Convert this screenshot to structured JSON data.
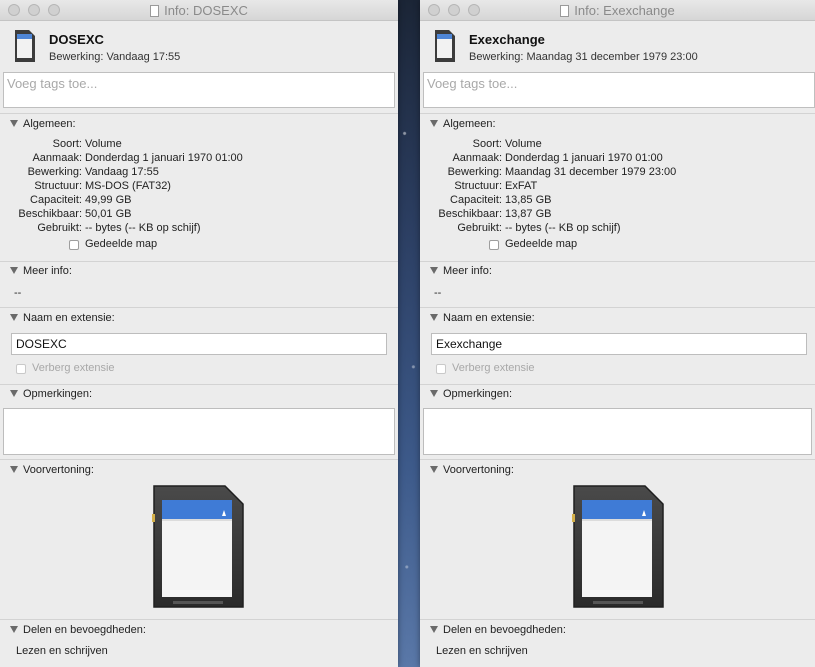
{
  "left": {
    "title": "Info: DOSEXC",
    "name": "DOSEXC",
    "modified_header": "Bewerking: Vandaag 17:55",
    "tags_placeholder": "Voeg tags toe...",
    "sections": {
      "general": "Algemeen:",
      "more_info": "Meer info:",
      "name_ext": "Naam en extensie:",
      "comments": "Opmerkingen:",
      "preview": "Voorvertoning:",
      "sharing": "Delen en bevoegdheden:"
    },
    "general": [
      {
        "k": "Soort:",
        "v": "Volume"
      },
      {
        "k": "Aanmaak:",
        "v": "Donderdag 1 januari 1970 01:00"
      },
      {
        "k": "Bewerking:",
        "v": "Vandaag 17:55"
      },
      {
        "k": "Structuur:",
        "v": "MS-DOS (FAT32)"
      },
      {
        "k": "Capaciteit:",
        "v": "49,99 GB"
      },
      {
        "k": "Beschikbaar:",
        "v": "50,01 GB"
      },
      {
        "k": "Gebruikt:",
        "v": "-- bytes (-- KB op schijf)"
      }
    ],
    "shared_folder": "Gedeelde map",
    "more_info_value": "--",
    "name_value": "DOSEXC",
    "hide_extension": "Verberg extensie",
    "sharing_value": "Lezen en schrijven"
  },
  "right": {
    "title": "Info: Exexchange",
    "name": "Exexchange",
    "modified_header": "Bewerking: Maandag 31 december 1979 23:00",
    "tags_placeholder": "Voeg tags toe...",
    "sections": {
      "general": "Algemeen:",
      "more_info": "Meer info:",
      "name_ext": "Naam en extensie:",
      "comments": "Opmerkingen:",
      "preview": "Voorvertoning:",
      "sharing": "Delen en bevoegdheden:"
    },
    "general": [
      {
        "k": "Soort:",
        "v": "Volume"
      },
      {
        "k": "Aanmaak:",
        "v": "Donderdag 1 januari 1970 01:00"
      },
      {
        "k": "Bewerking:",
        "v": "Maandag 31 december 1979 23:00"
      },
      {
        "k": "Structuur:",
        "v": "ExFAT"
      },
      {
        "k": "Capaciteit:",
        "v": "13,85 GB"
      },
      {
        "k": "Beschikbaar:",
        "v": "13,87 GB"
      },
      {
        "k": "Gebruikt:",
        "v": "-- bytes (-- KB op schijf)"
      }
    ],
    "shared_folder": "Gedeelde map",
    "more_info_value": "--",
    "name_value": "Exexchange",
    "hide_extension": "Verberg extensie",
    "sharing_value": "Lezen en schrijven"
  },
  "icons": {
    "sd_card": "sd-card-icon",
    "disclosure": "disclosure-triangle-icon",
    "document": "document-icon"
  }
}
